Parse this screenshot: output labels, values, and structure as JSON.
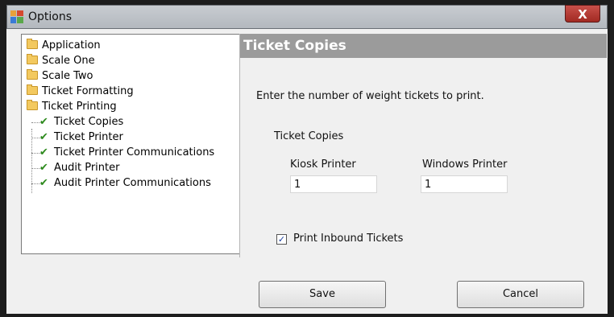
{
  "window": {
    "title": "Options",
    "close_label": "X"
  },
  "tree": {
    "folders": [
      {
        "label": "Application"
      },
      {
        "label": "Scale One"
      },
      {
        "label": "Scale Two"
      },
      {
        "label": "Ticket Formatting"
      },
      {
        "label": "Ticket Printing"
      }
    ],
    "children": [
      {
        "label": "Ticket Copies"
      },
      {
        "label": "Ticket Printer"
      },
      {
        "label": "Ticket Printer Communications"
      },
      {
        "label": "Audit Printer"
      },
      {
        "label": "Audit Printer Communications"
      }
    ]
  },
  "panel": {
    "title": "Ticket Copies",
    "description": "Enter the number of weight tickets to print.",
    "section_label": "Ticket Copies",
    "kiosk_label": "Kiosk Printer",
    "kiosk_value": "1",
    "windows_label": "Windows Printer",
    "windows_value": "1",
    "inbound_label": "Print Inbound Tickets",
    "inbound_checked": true
  },
  "buttons": {
    "save": "Save",
    "cancel": "Cancel"
  },
  "colors": {
    "panel_header": "#9b9b9b",
    "check_green": "#2e8b1e"
  }
}
